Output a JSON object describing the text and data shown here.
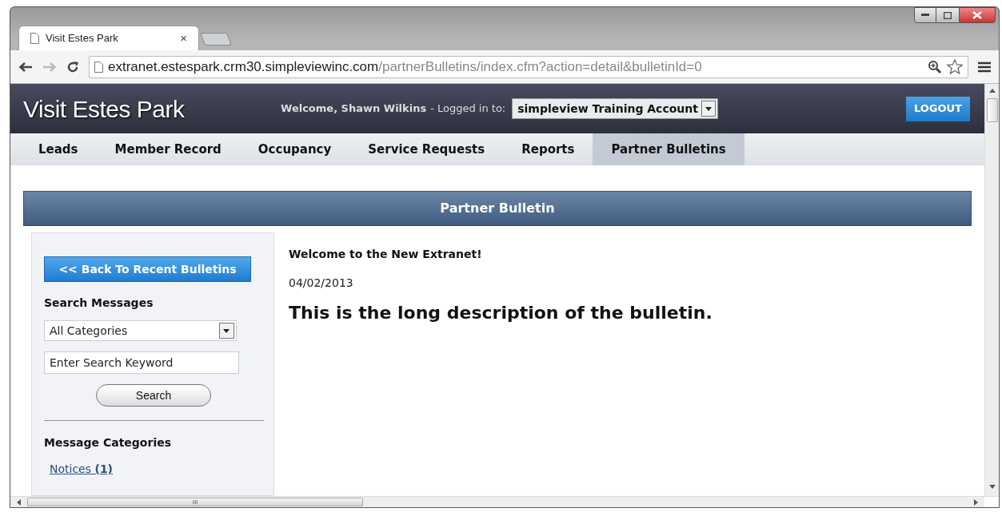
{
  "browser": {
    "tab": {
      "title": "Visit Estes Park",
      "close": "×"
    },
    "url": {
      "host": "extranet.estespark.crm30.simpleviewinc.com",
      "path": "/partnerBulletins/index.cfm?action=detail&bulletinId=0"
    }
  },
  "header": {
    "site_title": "Visit Estes Park",
    "welcome": "Welcome, Shawn Wilkins",
    "logged_in_label": "- Logged in to:",
    "account": "simpleview Training Account",
    "logout": "LOGOUT"
  },
  "nav": [
    {
      "label": "Leads",
      "selected": false
    },
    {
      "label": "Member Record",
      "selected": false
    },
    {
      "label": "Occupancy",
      "selected": false
    },
    {
      "label": "Service Requests",
      "selected": false
    },
    {
      "label": "Reports",
      "selected": false
    },
    {
      "label": "Partner Bulletins",
      "selected": true
    }
  ],
  "section_title": "Partner Bulletin",
  "sidebar": {
    "back_button": "<< Back To Recent Bulletins",
    "search_heading": "Search Messages",
    "category_select": "All Categories",
    "keyword_placeholder": "Enter Search Keyword",
    "search_button": "Search",
    "categories_heading": "Message Categories",
    "categories": [
      {
        "name": "Notices",
        "count": "(1)"
      }
    ]
  },
  "bulletin": {
    "title": "Welcome to the New Extranet!",
    "date": "04/02/2013",
    "description": "This is the long description of the bulletin."
  },
  "scrollbar_grip": "III"
}
